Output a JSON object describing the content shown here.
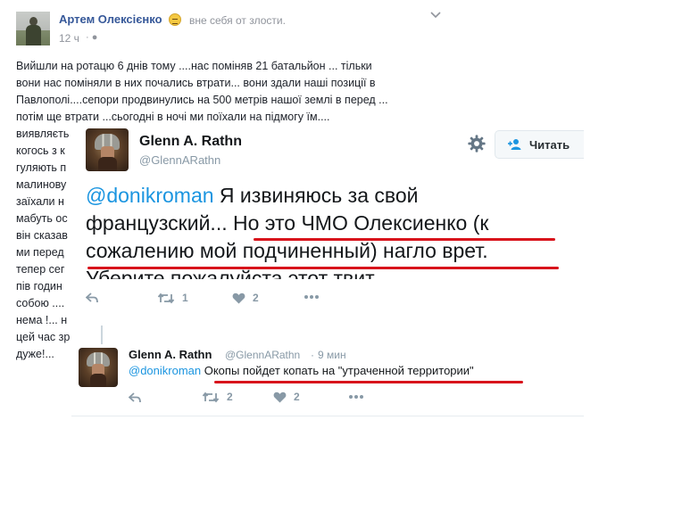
{
  "facebook_post": {
    "author": "Артем Олексієнко",
    "feeling": "вне себя от злости.",
    "time": "12 ч",
    "privacy": "·",
    "text_lines": [
      "Вийшли на ротацю 6 днів тому ....нас поміняв 21 батальйон ... тільки",
      "вони нас поміняли в них почались втрати... вони здали наші позиції в",
      "Павлополі....сепори продвинулись на 500 метрів нашої землі в перед ...",
      "потім ще втрати ...сьогодні в ночі ми поїхали на підмогу їм....",
      "виявляєть",
      "когось з к",
      "гуляють п",
      "малинову",
      "заїхали н",
      "мабуть ос",
      "він сказав",
      "ми перед",
      "тепер сег",
      "пів годин",
      "собою ....",
      "нема !... н",
      "цей час зр",
      "дуже!..."
    ]
  },
  "main_tweet": {
    "name": "Glenn A. Rathn",
    "handle": "@GlennARathn",
    "follow_label": "Читать",
    "mention": "@donikroman",
    "text_l1_rest": " Я извиняюсь за свой",
    "text_l2": "французский... Но это ЧМО Олексиенко (к",
    "text_l3": "сожалению мой подчиненный) нагло врет.",
    "text_l4_cut": "Уберите пожалуйста этот твит",
    "retweets": "1",
    "likes": "2"
  },
  "reply_tweet": {
    "name": "Glenn A. Rathn",
    "handle": "@GlennARathn",
    "separator": "·",
    "time": "9 мин",
    "mention": "@donikroman",
    "text_rest": " Окопы пойдет копать на \"утраченной территории\"",
    "retweets": "2",
    "likes": "2"
  },
  "colors": {
    "facebook_link": "#365899",
    "twitter_blue": "#1b95e0",
    "underline_red": "#d8141c",
    "meta_gray": "#8899a6"
  },
  "icons": [
    "settings-gear-icon",
    "follow-person-plus-icon",
    "reply-arrow-icon",
    "retweet-icon",
    "like-heart-icon",
    "more-dots-icon",
    "chevron-down-icon",
    "feeling-angry-emoji-icon",
    "globe-privacy-icon"
  ]
}
